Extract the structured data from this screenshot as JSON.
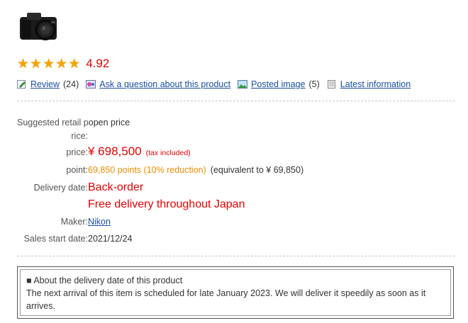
{
  "product": {
    "image_alt": "Nikon camera"
  },
  "rating": {
    "stars": 5,
    "score": "4.92"
  },
  "links": {
    "review": {
      "label": "Review",
      "count": "(24)"
    },
    "question": {
      "label": "Ask a question about this product"
    },
    "image": {
      "label": "Posted image",
      "count": "(5)"
    },
    "latest": {
      "label": "Latest information"
    }
  },
  "details": {
    "retail_label_line1": "Suggested retail p",
    "retail_value": "open price",
    "retail_label_line2": "rice:",
    "price_label": "price:",
    "price_value": "¥ 698,500",
    "price_tax": "(tax included)",
    "point_label": "point:",
    "point_value": "69,850 points (10% reduction)",
    "point_equiv": "(equivalent to ¥ 69,850)",
    "delivery_label": "Delivery date:",
    "delivery_value": "Back-order",
    "delivery_note": "Free delivery throughout Japan",
    "maker_label": "Maker:",
    "maker_value": "Nikon",
    "sales_label": "Sales start date:",
    "sales_value": "2021/12/24"
  },
  "notice": {
    "title": "■ About the delivery date of this product",
    "body": "The next arrival of this item is scheduled for late January 2023. We will deliver it speedily as soon as it arrives."
  },
  "colors": {
    "accent_red": "#e60000",
    "points_orange": "#f28c00",
    "link_blue": "#1a4fa3",
    "star": "#f5a400"
  }
}
